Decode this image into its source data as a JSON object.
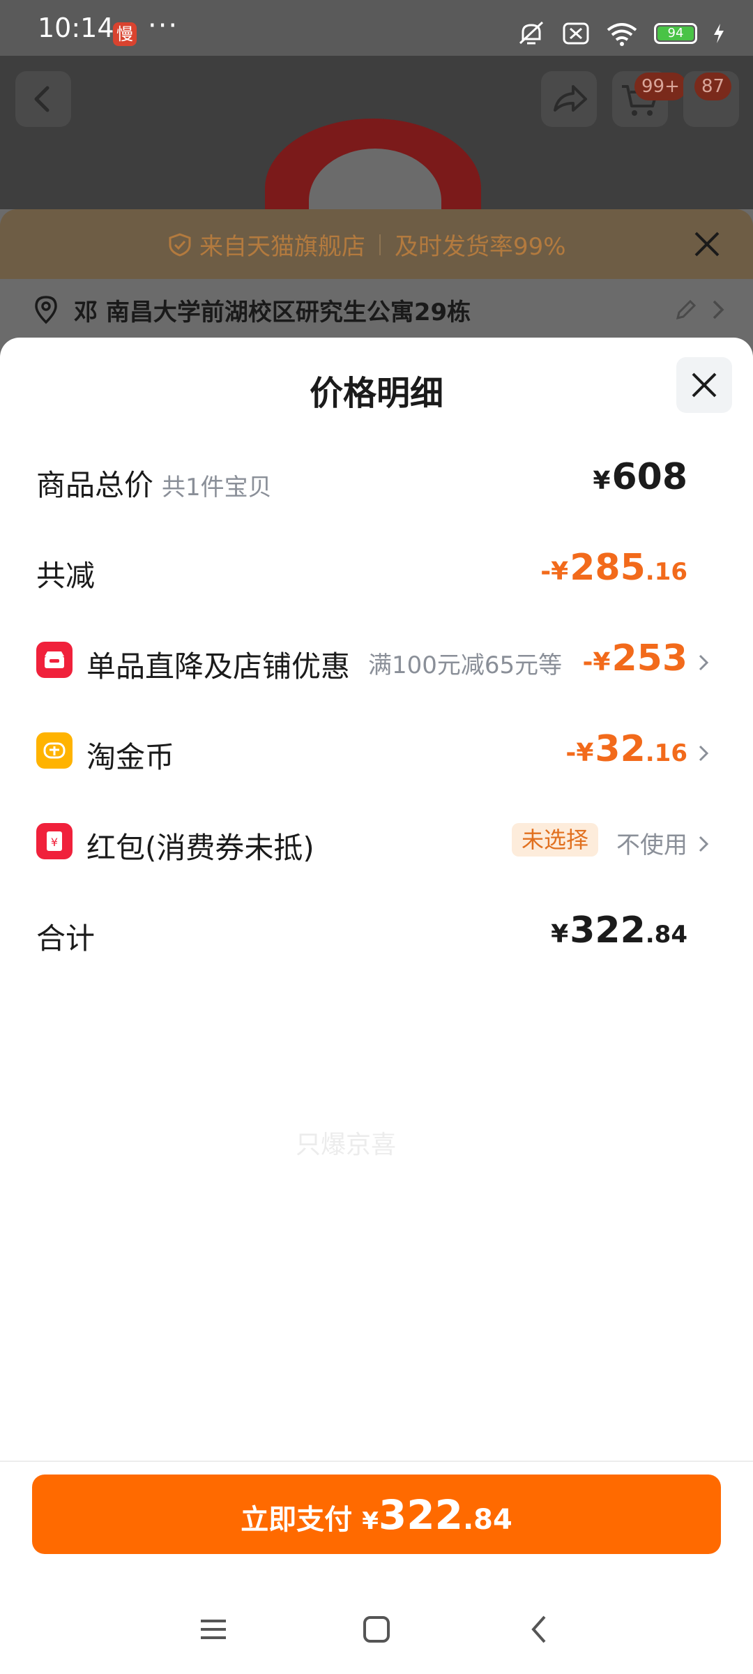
{
  "status_bar": {
    "time": "10:14",
    "app_badge": "慢",
    "more": "···",
    "battery": "94",
    "icons": [
      "mute-icon",
      "sim-off-icon",
      "wifi-icon",
      "battery-icon",
      "charging-icon"
    ]
  },
  "header": {
    "back_icon": "back-icon",
    "share_icon": "share-icon",
    "cart_badge": "99+",
    "message_badge": "87"
  },
  "notice": {
    "source": "来自天猫旗舰店",
    "rate": "及时发货率99%",
    "icon": "shield-icon"
  },
  "address": {
    "text": "邓  南昌大学前湖校区研究生公寓29栋"
  },
  "sheet": {
    "title": "价格明细",
    "rows": {
      "total": {
        "label": "商品总价",
        "sub": "共1件宝贝",
        "currency": "¥",
        "int": "608",
        "dec": ""
      },
      "discount": {
        "label": "共减",
        "prefix": "-¥",
        "int": "285",
        "dec": ".16"
      },
      "store": {
        "label": "单品直降及店铺优惠",
        "note": "满100元减65元等",
        "prefix": "-¥",
        "int": "253",
        "dec": "",
        "icon": "store-icon"
      },
      "coins": {
        "label": "淘金币",
        "prefix": "-¥",
        "int": "32",
        "dec": ".16",
        "icon": "coin-icon"
      },
      "redpacket": {
        "label": "红包(消费券未抵)",
        "pill": "未选择",
        "action": "不使用",
        "icon": "redpacket-icon"
      },
      "sum": {
        "label": "合计",
        "currency": "¥",
        "int": "322",
        "dec": ".84"
      }
    },
    "watermark": "只爆京喜"
  },
  "pay": {
    "label": "立即支付",
    "currency": "¥",
    "int": "322",
    "dec": ".84"
  },
  "colors": {
    "accent": "#ff6a00",
    "discount": "#f26a1b",
    "text": "#1b1b1b",
    "muted": "#8a8f98"
  }
}
